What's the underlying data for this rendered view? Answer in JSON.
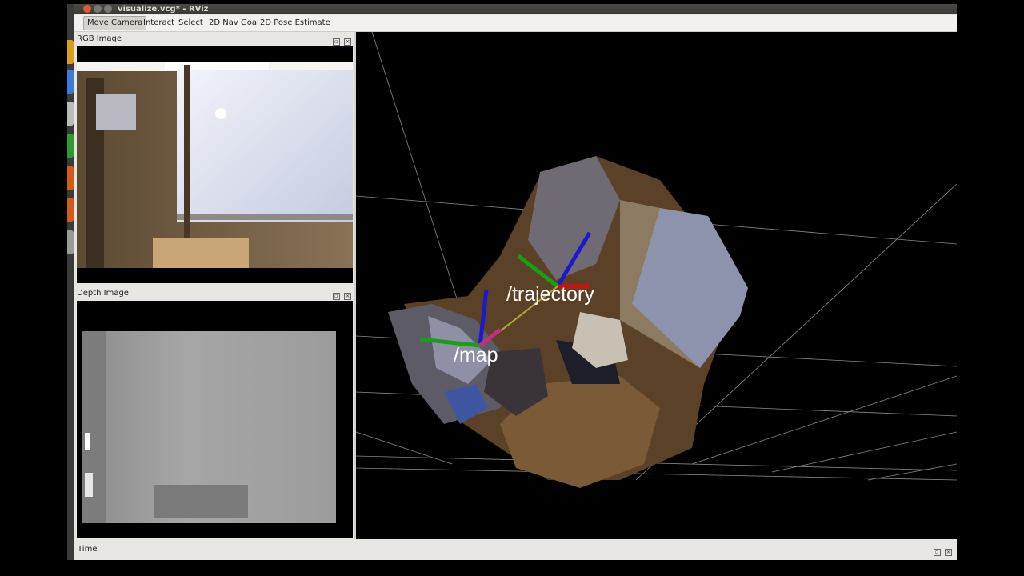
{
  "window": {
    "title": "visualize.vcg* - RViz"
  },
  "toolbar": {
    "tools": [
      "Move Camera",
      "Interact",
      "Select",
      "2D Nav Goal",
      "2D Pose Estimate"
    ],
    "active_tool": "Move Camera"
  },
  "panels": {
    "rgb": {
      "title": "RGB Image"
    },
    "depth": {
      "title": "Depth Image"
    },
    "time": {
      "title": "Time"
    }
  },
  "viewport": {
    "frames": {
      "trajectory": "/trajectory",
      "map": "/map"
    }
  },
  "colors": {
    "axis_x": "#d01010",
    "axis_y": "#17a017",
    "axis_z": "#1a1acc",
    "active_close": "#e05a2a"
  },
  "icons": {
    "panel_undock": "undock-icon",
    "panel_close": "close-icon"
  }
}
